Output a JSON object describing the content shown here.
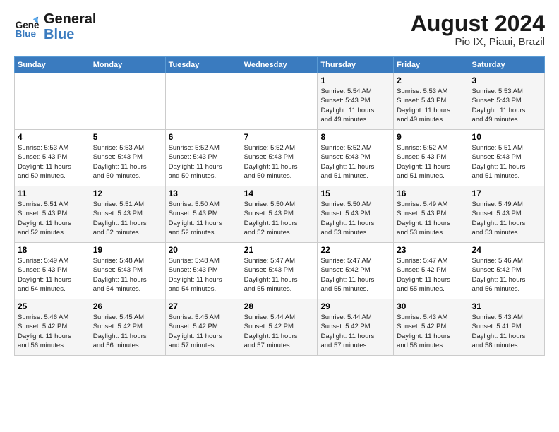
{
  "logo": {
    "line1": "General",
    "line2": "Blue"
  },
  "title": "August 2024",
  "subtitle": "Pio IX, Piaui, Brazil",
  "weekdays": [
    "Sunday",
    "Monday",
    "Tuesday",
    "Wednesday",
    "Thursday",
    "Friday",
    "Saturday"
  ],
  "weeks": [
    [
      {
        "day": "",
        "info": ""
      },
      {
        "day": "",
        "info": ""
      },
      {
        "day": "",
        "info": ""
      },
      {
        "day": "",
        "info": ""
      },
      {
        "day": "1",
        "info": "Sunrise: 5:54 AM\nSunset: 5:43 PM\nDaylight: 11 hours\nand 49 minutes."
      },
      {
        "day": "2",
        "info": "Sunrise: 5:53 AM\nSunset: 5:43 PM\nDaylight: 11 hours\nand 49 minutes."
      },
      {
        "day": "3",
        "info": "Sunrise: 5:53 AM\nSunset: 5:43 PM\nDaylight: 11 hours\nand 49 minutes."
      }
    ],
    [
      {
        "day": "4",
        "info": "Sunrise: 5:53 AM\nSunset: 5:43 PM\nDaylight: 11 hours\nand 50 minutes."
      },
      {
        "day": "5",
        "info": "Sunrise: 5:53 AM\nSunset: 5:43 PM\nDaylight: 11 hours\nand 50 minutes."
      },
      {
        "day": "6",
        "info": "Sunrise: 5:52 AM\nSunset: 5:43 PM\nDaylight: 11 hours\nand 50 minutes."
      },
      {
        "day": "7",
        "info": "Sunrise: 5:52 AM\nSunset: 5:43 PM\nDaylight: 11 hours\nand 50 minutes."
      },
      {
        "day": "8",
        "info": "Sunrise: 5:52 AM\nSunset: 5:43 PM\nDaylight: 11 hours\nand 51 minutes."
      },
      {
        "day": "9",
        "info": "Sunrise: 5:52 AM\nSunset: 5:43 PM\nDaylight: 11 hours\nand 51 minutes."
      },
      {
        "day": "10",
        "info": "Sunrise: 5:51 AM\nSunset: 5:43 PM\nDaylight: 11 hours\nand 51 minutes."
      }
    ],
    [
      {
        "day": "11",
        "info": "Sunrise: 5:51 AM\nSunset: 5:43 PM\nDaylight: 11 hours\nand 52 minutes."
      },
      {
        "day": "12",
        "info": "Sunrise: 5:51 AM\nSunset: 5:43 PM\nDaylight: 11 hours\nand 52 minutes."
      },
      {
        "day": "13",
        "info": "Sunrise: 5:50 AM\nSunset: 5:43 PM\nDaylight: 11 hours\nand 52 minutes."
      },
      {
        "day": "14",
        "info": "Sunrise: 5:50 AM\nSunset: 5:43 PM\nDaylight: 11 hours\nand 52 minutes."
      },
      {
        "day": "15",
        "info": "Sunrise: 5:50 AM\nSunset: 5:43 PM\nDaylight: 11 hours\nand 53 minutes."
      },
      {
        "day": "16",
        "info": "Sunrise: 5:49 AM\nSunset: 5:43 PM\nDaylight: 11 hours\nand 53 minutes."
      },
      {
        "day": "17",
        "info": "Sunrise: 5:49 AM\nSunset: 5:43 PM\nDaylight: 11 hours\nand 53 minutes."
      }
    ],
    [
      {
        "day": "18",
        "info": "Sunrise: 5:49 AM\nSunset: 5:43 PM\nDaylight: 11 hours\nand 54 minutes."
      },
      {
        "day": "19",
        "info": "Sunrise: 5:48 AM\nSunset: 5:43 PM\nDaylight: 11 hours\nand 54 minutes."
      },
      {
        "day": "20",
        "info": "Sunrise: 5:48 AM\nSunset: 5:43 PM\nDaylight: 11 hours\nand 54 minutes."
      },
      {
        "day": "21",
        "info": "Sunrise: 5:47 AM\nSunset: 5:43 PM\nDaylight: 11 hours\nand 55 minutes."
      },
      {
        "day": "22",
        "info": "Sunrise: 5:47 AM\nSunset: 5:42 PM\nDaylight: 11 hours\nand 55 minutes."
      },
      {
        "day": "23",
        "info": "Sunrise: 5:47 AM\nSunset: 5:42 PM\nDaylight: 11 hours\nand 55 minutes."
      },
      {
        "day": "24",
        "info": "Sunrise: 5:46 AM\nSunset: 5:42 PM\nDaylight: 11 hours\nand 56 minutes."
      }
    ],
    [
      {
        "day": "25",
        "info": "Sunrise: 5:46 AM\nSunset: 5:42 PM\nDaylight: 11 hours\nand 56 minutes."
      },
      {
        "day": "26",
        "info": "Sunrise: 5:45 AM\nSunset: 5:42 PM\nDaylight: 11 hours\nand 56 minutes."
      },
      {
        "day": "27",
        "info": "Sunrise: 5:45 AM\nSunset: 5:42 PM\nDaylight: 11 hours\nand 57 minutes."
      },
      {
        "day": "28",
        "info": "Sunrise: 5:44 AM\nSunset: 5:42 PM\nDaylight: 11 hours\nand 57 minutes."
      },
      {
        "day": "29",
        "info": "Sunrise: 5:44 AM\nSunset: 5:42 PM\nDaylight: 11 hours\nand 57 minutes."
      },
      {
        "day": "30",
        "info": "Sunrise: 5:43 AM\nSunset: 5:42 PM\nDaylight: 11 hours\nand 58 minutes."
      },
      {
        "day": "31",
        "info": "Sunrise: 5:43 AM\nSunset: 5:41 PM\nDaylight: 11 hours\nand 58 minutes."
      }
    ]
  ]
}
